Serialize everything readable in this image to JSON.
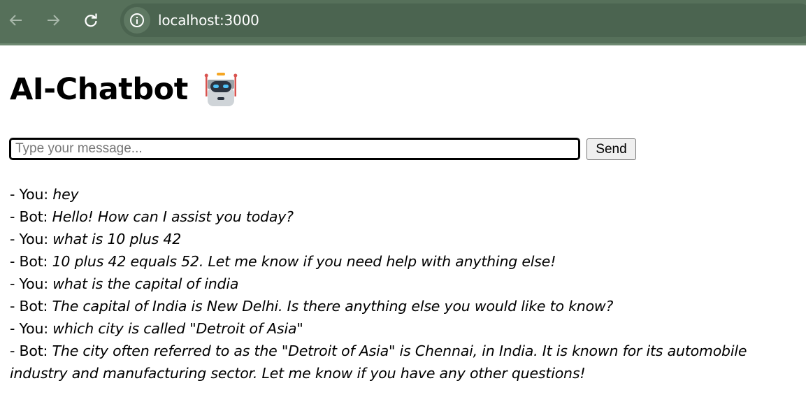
{
  "browser": {
    "url": "localhost:3000",
    "colors": {
      "toolbar": "#56705a",
      "url_bar": "#4b6450"
    }
  },
  "header": {
    "title": "AI-Chatbot",
    "icon": "robot-emoji-icon"
  },
  "composer": {
    "placeholder": "Type your message...",
    "value": "",
    "send_label": "Send"
  },
  "messages": [
    {
      "prefix": "- You: ",
      "text": "hey"
    },
    {
      "prefix": "- Bot: ",
      "text": "Hello! How can I assist you today?"
    },
    {
      "prefix": "- You: ",
      "text": "what is 10 plus 42"
    },
    {
      "prefix": "- Bot: ",
      "text": "10 plus 42 equals 52. Let me know if you need help with anything else!"
    },
    {
      "prefix": "- You: ",
      "text": "what is the capital of india"
    },
    {
      "prefix": "- Bot: ",
      "text": "The capital of India is New Delhi. Is there anything else you would like to know?"
    },
    {
      "prefix": "- You: ",
      "text": "which city is called \"Detroit of Asia\""
    },
    {
      "prefix": "- Bot: ",
      "text": "The city often referred to as the \"Detroit of Asia\" is Chennai, in India. It is known for its automobile industry and manufacturing sector. Let me know if you have any other questions!"
    }
  ]
}
